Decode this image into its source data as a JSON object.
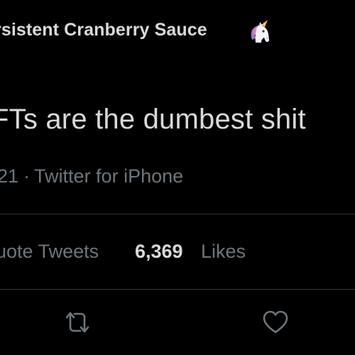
{
  "tweet": {
    "author_name": "rsistent Cranberry Sauce",
    "author_emoji": "unicorn-icon",
    "text": "FTs are the dumbest shit",
    "meta": {
      "date_fragment": "21",
      "separator": "·",
      "client": "Twitter for iPhone"
    },
    "stats": {
      "quote_tweets_label": "uote Tweets",
      "likes_count": "6,369",
      "likes_label": "Likes"
    },
    "actions": [
      {
        "name": "retweet",
        "icon": "retweet-icon"
      },
      {
        "name": "like",
        "icon": "heart-icon"
      }
    ]
  },
  "colors": {
    "background": "#000000",
    "primary_text": "#d9d9d9",
    "secondary_text": "#6e767d",
    "divider": "#2f3336"
  }
}
